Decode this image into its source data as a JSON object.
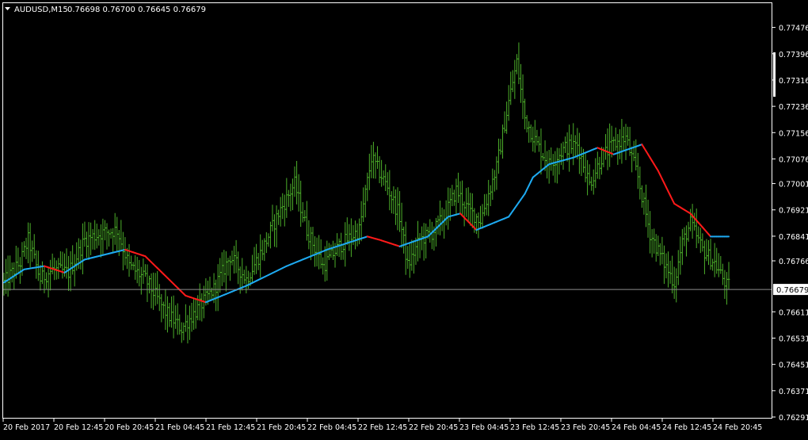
{
  "header": {
    "symbol": "AUDUSD,M15",
    "quote": "0.76698 0.76700 0.76645 0.76679",
    "menu_icon": "triangle-down-icon"
  },
  "colors": {
    "background": "#000000",
    "foreground": "#ffffff",
    "bars": "#4caf2a",
    "ma_rising": "#1eaaf1",
    "ma_falling": "#ff1a1a",
    "price_line": "#8c8c8c",
    "axis": "#ffffff"
  },
  "chart_data": {
    "type": "line",
    "title": "AUDUSD,M15",
    "series_style": "bar-ohlc",
    "xlabel": "",
    "ylabel": "",
    "ylim": [
      0.76291,
      0.77516
    ],
    "grid": false,
    "current_price": 0.76679,
    "current_price_label": "0.76679",
    "y_ticks": [
      "0.77476",
      "0.77396",
      "0.77316",
      "0.77236",
      "0.77156",
      "0.77076",
      "0.77001",
      "0.76921",
      "0.76841",
      "0.76766",
      "0.76611",
      "0.76531",
      "0.76451",
      "0.76371",
      "0.76291"
    ],
    "x_ticks": [
      "20 Feb 2017",
      "20 Feb 12:45",
      "20 Feb 20:45",
      "21 Feb 04:45",
      "21 Feb 12:45",
      "21 Feb 20:45",
      "22 Feb 04:45",
      "22 Feb 12:45",
      "22 Feb 20:45",
      "23 Feb 04:45",
      "23 Feb 12:45",
      "23 Feb 20:45",
      "24 Feb 04:45",
      "24 Feb 12:45",
      "24 Feb 20:45"
    ],
    "price_anchors": [
      [
        0,
        0.767
      ],
      [
        8,
        0.7676
      ],
      [
        12,
        0.7683
      ],
      [
        18,
        0.7671
      ],
      [
        24,
        0.7674
      ],
      [
        32,
        0.7673
      ],
      [
        40,
        0.7683
      ],
      [
        48,
        0.7685
      ],
      [
        56,
        0.7686
      ],
      [
        62,
        0.7675
      ],
      [
        70,
        0.7671
      ],
      [
        80,
        0.7661
      ],
      [
        88,
        0.7656
      ],
      [
        96,
        0.7662
      ],
      [
        104,
        0.7668
      ],
      [
        112,
        0.7678
      ],
      [
        120,
        0.7671
      ],
      [
        128,
        0.768
      ],
      [
        136,
        0.7691
      ],
      [
        144,
        0.77
      ],
      [
        150,
        0.7686
      ],
      [
        158,
        0.7675
      ],
      [
        166,
        0.7681
      ],
      [
        176,
        0.7686
      ],
      [
        182,
        0.7708
      ],
      [
        190,
        0.7699
      ],
      [
        196,
        0.769
      ],
      [
        200,
        0.7675
      ],
      [
        206,
        0.7683
      ],
      [
        212,
        0.7685
      ],
      [
        218,
        0.769
      ],
      [
        224,
        0.7698
      ],
      [
        230,
        0.7692
      ],
      [
        236,
        0.7689
      ],
      [
        244,
        0.7705
      ],
      [
        250,
        0.7725
      ],
      [
        254,
        0.7737
      ],
      [
        258,
        0.772
      ],
      [
        264,
        0.7712
      ],
      [
        270,
        0.7706
      ],
      [
        278,
        0.7711
      ],
      [
        284,
        0.7712
      ],
      [
        290,
        0.77
      ],
      [
        296,
        0.7708
      ],
      [
        302,
        0.7712
      ],
      [
        308,
        0.7714
      ],
      [
        314,
        0.7702
      ],
      [
        320,
        0.7685
      ],
      [
        326,
        0.7677
      ],
      [
        332,
        0.767
      ],
      [
        336,
        0.7682
      ],
      [
        340,
        0.7688
      ],
      [
        346,
        0.768
      ],
      [
        352,
        0.7676
      ],
      [
        358,
        0.7669
      ]
    ],
    "ma_anchors": [
      [
        0,
        0.767
      ],
      [
        10,
        0.7674
      ],
      [
        20,
        0.7675
      ],
      [
        30,
        0.7673
      ],
      [
        40,
        0.7677
      ],
      [
        60,
        0.768
      ],
      [
        70,
        0.7678
      ],
      [
        80,
        0.7672
      ],
      [
        90,
        0.7666
      ],
      [
        100,
        0.7664
      ],
      [
        120,
        0.7669
      ],
      [
        140,
        0.7675
      ],
      [
        160,
        0.768
      ],
      [
        180,
        0.7684
      ],
      [
        186,
        0.7683
      ],
      [
        196,
        0.7681
      ],
      [
        210,
        0.7684
      ],
      [
        220,
        0.769
      ],
      [
        226,
        0.7691
      ],
      [
        234,
        0.7686
      ],
      [
        250,
        0.769
      ],
      [
        258,
        0.7697
      ],
      [
        262,
        0.7702
      ],
      [
        270,
        0.7706
      ],
      [
        282,
        0.7708
      ],
      [
        294,
        0.7711
      ],
      [
        302,
        0.7709
      ],
      [
        316,
        0.7712
      ],
      [
        324,
        0.7704
      ],
      [
        332,
        0.7694
      ],
      [
        340,
        0.7691
      ],
      [
        350,
        0.7684
      ]
    ],
    "bar_count": 360
  }
}
